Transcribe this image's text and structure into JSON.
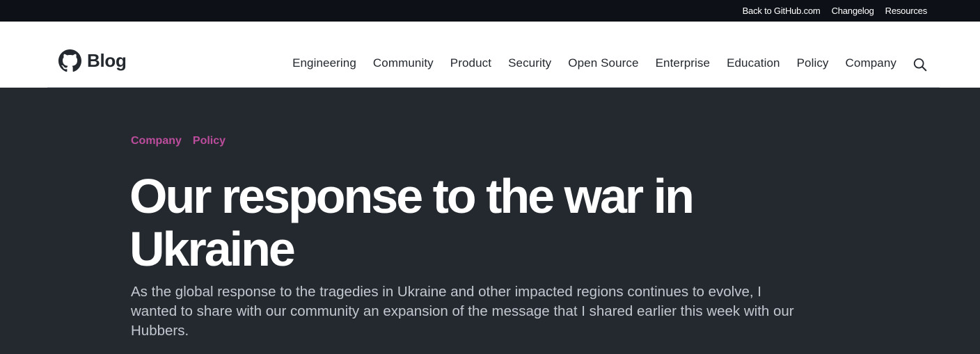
{
  "topbar": {
    "links": [
      "Back to GitHub.com",
      "Changelog",
      "Resources"
    ]
  },
  "header": {
    "brand": "Blog",
    "logo_icon": "github-octocat-icon",
    "nav": [
      "Engineering",
      "Community",
      "Product",
      "Security",
      "Open Source",
      "Enterprise",
      "Education",
      "Policy",
      "Company"
    ],
    "search_icon": "search-icon"
  },
  "hero": {
    "tags": [
      "Company",
      "Policy"
    ],
    "title": "Our response to the war in Ukraine",
    "excerpt": "As the global response to the tragedies in Ukraine and other impacted regions continues to evolve, I wanted to share with our community an expansion of the message that I shared earlier this week with our Hubbers."
  },
  "colors": {
    "topbar_bg": "#0d1117",
    "hero_bg": "#24292f",
    "tag": "#bc4c9c",
    "text_dark": "#24292f"
  }
}
